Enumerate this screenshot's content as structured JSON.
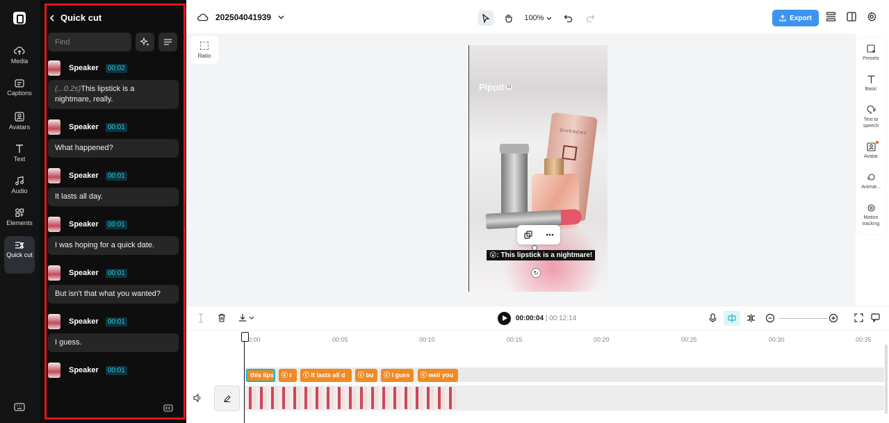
{
  "rail": {
    "items": [
      {
        "label": "Media",
        "icon": "cloud-upload-icon"
      },
      {
        "label": "Captions",
        "icon": "captions-icon"
      },
      {
        "label": "Avatars",
        "icon": "avatar-icon"
      },
      {
        "label": "Text",
        "icon": "text-icon"
      },
      {
        "label": "Audio",
        "icon": "music-note-icon"
      },
      {
        "label": "Elements",
        "icon": "elements-icon"
      },
      {
        "label": "Quick cut",
        "icon": "quick-cut-icon",
        "active": true
      }
    ]
  },
  "panel": {
    "title": "Quick cut",
    "search_placeholder": "Find",
    "entries": [
      {
        "speaker": "Speaker",
        "time": "00:02",
        "pause": "(...0.2s)",
        "text": "This lipstick is a nightmare, really."
      },
      {
        "speaker": "Speaker",
        "time": "00:01",
        "pause": "",
        "text": "What happened?"
      },
      {
        "speaker": "Speaker",
        "time": "00:01",
        "pause": "",
        "text": "It lasts all day."
      },
      {
        "speaker": "Speaker",
        "time": "00:01",
        "pause": "",
        "text": "I was hoping for a quick date."
      },
      {
        "speaker": "Speaker",
        "time": "00:01",
        "pause": "",
        "text": "But isn't that what you wanted?"
      },
      {
        "speaker": "Speaker",
        "time": "00:01",
        "pause": "",
        "text": "I guess."
      },
      {
        "speaker": "Speaker",
        "time": "00:01",
        "pause": "",
        "text": ""
      }
    ]
  },
  "topbar": {
    "project_name": "202504041939",
    "zoom": "100%",
    "export_label": "Export"
  },
  "canvas": {
    "ratio_label": "Ratio",
    "watermark": "Pippit",
    "watermark_badge": "AI",
    "product_brand": "GIVENCHY",
    "caption": "😮: This lipstick is a nightmare!"
  },
  "right_panel": {
    "items": [
      "Presets",
      "Basic",
      "Text to speech",
      "Avatar",
      "Animat...",
      "Motion tracking"
    ]
  },
  "timeline": {
    "current_time": "00:00:04",
    "total_time": "00:12:14",
    "ruler": [
      "00:00",
      "00:05",
      "00:10",
      "00:15",
      "00:20",
      "00:25",
      "00:30",
      "00:35"
    ],
    "caption_clips": [
      "this lips",
      "r",
      "It lasts all d",
      "bu",
      "I gues",
      "well you"
    ]
  },
  "colors": {
    "accent": "#3d93f0",
    "clip": "#f08a22",
    "highlight": "#e0161b",
    "time_badge": "#2ec3d6"
  }
}
